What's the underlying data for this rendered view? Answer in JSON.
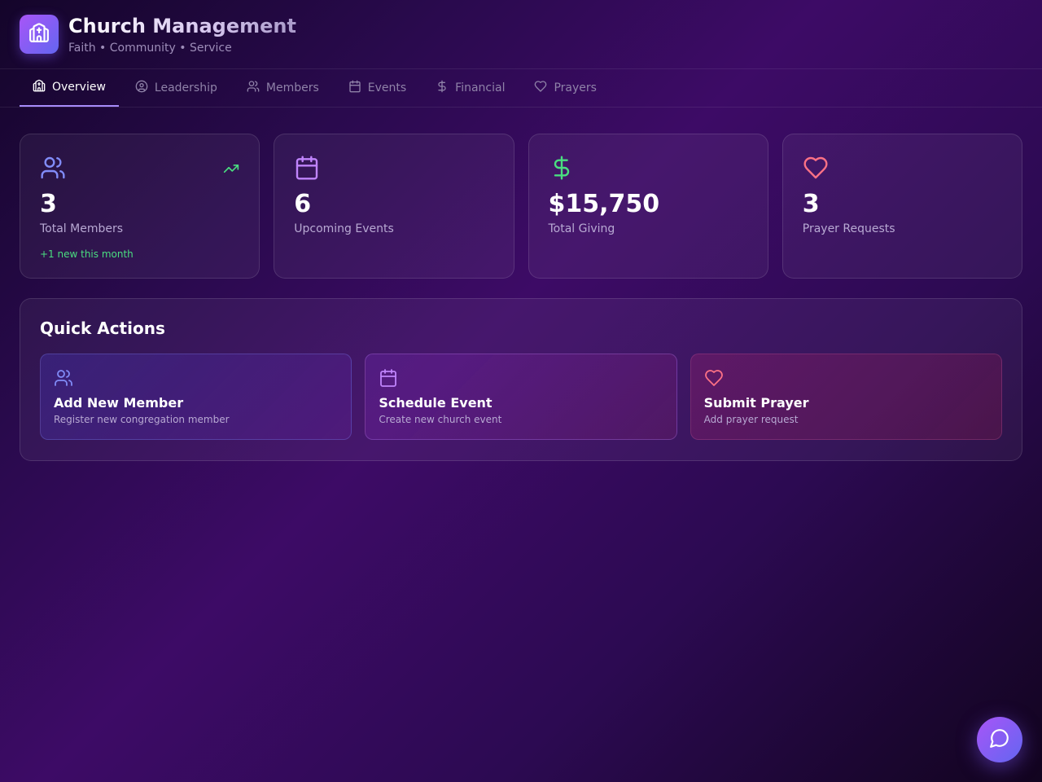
{
  "header": {
    "title": "Church Management",
    "subtitle": "Faith • Community • Service",
    "logo_icon": "church-icon"
  },
  "tabs": [
    {
      "label": "Overview",
      "icon": "church-icon",
      "active": true
    },
    {
      "label": "Leadership",
      "icon": "user-circle-icon",
      "active": false
    },
    {
      "label": "Members",
      "icon": "users-icon",
      "active": false
    },
    {
      "label": "Events",
      "icon": "calendar-icon",
      "active": false
    },
    {
      "label": "Financial",
      "icon": "dollar-icon",
      "active": false
    },
    {
      "label": "Prayers",
      "icon": "heart-icon",
      "active": false
    }
  ],
  "stats": [
    {
      "value": "3",
      "label": "Total Members",
      "note": "+1 new this month",
      "icon": "users-icon",
      "color": "#818cf8"
    },
    {
      "value": "6",
      "label": "Upcoming Events",
      "icon": "calendar-icon",
      "color": "#c084fc"
    },
    {
      "value": "$15,750",
      "label": "Total Giving",
      "icon": "dollar-icon",
      "color": "#4ade80"
    },
    {
      "value": "3",
      "label": "Prayer Requests",
      "icon": "heart-icon",
      "color": "#fb7185"
    }
  ],
  "quick_actions": {
    "title": "Quick Actions",
    "items": [
      {
        "title": "Add New Member",
        "description": "Register new congregation member",
        "icon": "users-icon",
        "color": "#818cf8"
      },
      {
        "title": "Schedule Event",
        "description": "Create new church event",
        "icon": "calendar-icon",
        "color": "#c084fc"
      },
      {
        "title": "Submit Prayer",
        "description": "Add prayer request",
        "icon": "heart-icon",
        "color": "#fb7185"
      }
    ]
  },
  "fab": {
    "icon": "chat-bubble-icon"
  },
  "colors": {
    "accent": "#a78bfa",
    "green": "#4ade80",
    "pink": "#fb7185",
    "indigo": "#818cf8",
    "purple": "#c084fc"
  }
}
